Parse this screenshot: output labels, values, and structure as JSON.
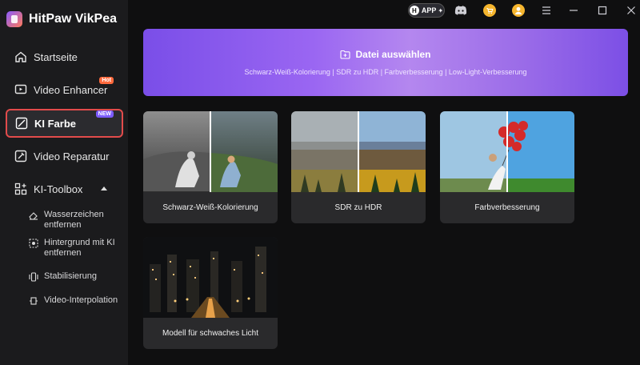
{
  "app": {
    "name": "HitPaw VikPea"
  },
  "sidebar": {
    "items": [
      {
        "label": "Startseite"
      },
      {
        "label": "Video Enhancer",
        "badge": "Hot"
      },
      {
        "label": "KI Farbe",
        "badge": "NEW"
      },
      {
        "label": "Video Reparatur"
      },
      {
        "label": "KI-Toolbox"
      }
    ],
    "sub_items": [
      {
        "label": "Wasserzeichen entfernen"
      },
      {
        "label": "Hintergrund mit KI entfernen"
      },
      {
        "label": "Stabilisierung"
      },
      {
        "label": "Video-Interpolation"
      }
    ]
  },
  "topbar": {
    "app_label": "APP",
    "app_h": "H"
  },
  "banner": {
    "title": "Datei auswählen",
    "subtitle": "Schwarz-Weiß-Kolorierung | SDR zu HDR  | Farbverbesserung | Low-Light-Verbesserung"
  },
  "cards": [
    {
      "label": "Schwarz-Weiß-Kolorierung"
    },
    {
      "label": "SDR zu HDR"
    },
    {
      "label": "Farbverbesserung"
    },
    {
      "label": "Modell für schwaches Licht"
    }
  ],
  "colors": {
    "accent": "#7c5cff",
    "active_border": "#e24b4b",
    "hot": "#ff6a3d"
  }
}
